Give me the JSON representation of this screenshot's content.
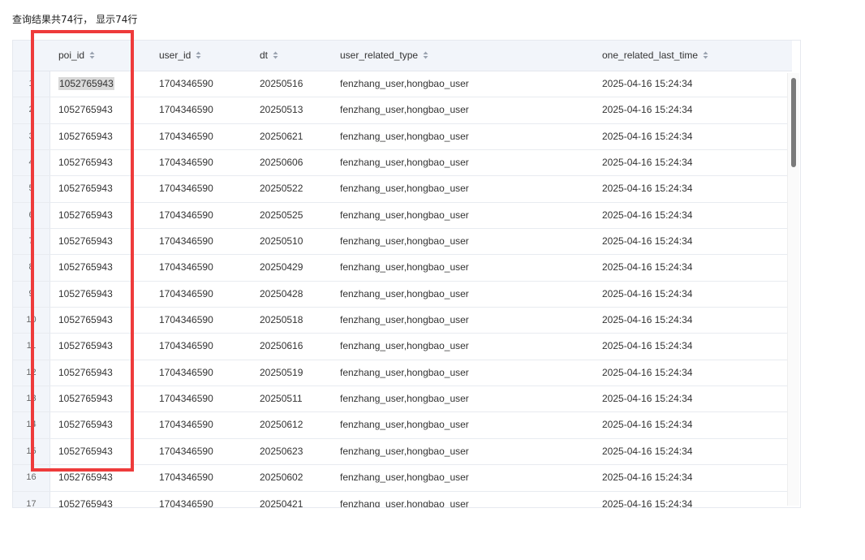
{
  "summary": "查询结果共74行， 显示74行",
  "columns": [
    {
      "key": "poi_id",
      "label": "poi_id"
    },
    {
      "key": "user_id",
      "label": "user_id"
    },
    {
      "key": "dt",
      "label": "dt"
    },
    {
      "key": "user_related_type",
      "label": "user_related_type"
    },
    {
      "key": "one_related_last_time",
      "label": "one_related_last_time"
    }
  ],
  "rows": [
    {
      "idx": "1",
      "poi_id": "1052765943",
      "user_id": "1704346590",
      "dt": "20250516",
      "user_related_type": "fenzhang_user,hongbao_user",
      "one_related_last_time": "2025-04-16 15:24:34"
    },
    {
      "idx": "2",
      "poi_id": "1052765943",
      "user_id": "1704346590",
      "dt": "20250513",
      "user_related_type": "fenzhang_user,hongbao_user",
      "one_related_last_time": "2025-04-16 15:24:34"
    },
    {
      "idx": "3",
      "poi_id": "1052765943",
      "user_id": "1704346590",
      "dt": "20250621",
      "user_related_type": "fenzhang_user,hongbao_user",
      "one_related_last_time": "2025-04-16 15:24:34"
    },
    {
      "idx": "4",
      "poi_id": "1052765943",
      "user_id": "1704346590",
      "dt": "20250606",
      "user_related_type": "fenzhang_user,hongbao_user",
      "one_related_last_time": "2025-04-16 15:24:34"
    },
    {
      "idx": "5",
      "poi_id": "1052765943",
      "user_id": "1704346590",
      "dt": "20250522",
      "user_related_type": "fenzhang_user,hongbao_user",
      "one_related_last_time": "2025-04-16 15:24:34"
    },
    {
      "idx": "6",
      "poi_id": "1052765943",
      "user_id": "1704346590",
      "dt": "20250525",
      "user_related_type": "fenzhang_user,hongbao_user",
      "one_related_last_time": "2025-04-16 15:24:34"
    },
    {
      "idx": "7",
      "poi_id": "1052765943",
      "user_id": "1704346590",
      "dt": "20250510",
      "user_related_type": "fenzhang_user,hongbao_user",
      "one_related_last_time": "2025-04-16 15:24:34"
    },
    {
      "idx": "8",
      "poi_id": "1052765943",
      "user_id": "1704346590",
      "dt": "20250429",
      "user_related_type": "fenzhang_user,hongbao_user",
      "one_related_last_time": "2025-04-16 15:24:34"
    },
    {
      "idx": "9",
      "poi_id": "1052765943",
      "user_id": "1704346590",
      "dt": "20250428",
      "user_related_type": "fenzhang_user,hongbao_user",
      "one_related_last_time": "2025-04-16 15:24:34"
    },
    {
      "idx": "10",
      "poi_id": "1052765943",
      "user_id": "1704346590",
      "dt": "20250518",
      "user_related_type": "fenzhang_user,hongbao_user",
      "one_related_last_time": "2025-04-16 15:24:34"
    },
    {
      "idx": "11",
      "poi_id": "1052765943",
      "user_id": "1704346590",
      "dt": "20250616",
      "user_related_type": "fenzhang_user,hongbao_user",
      "one_related_last_time": "2025-04-16 15:24:34"
    },
    {
      "idx": "12",
      "poi_id": "1052765943",
      "user_id": "1704346590",
      "dt": "20250519",
      "user_related_type": "fenzhang_user,hongbao_user",
      "one_related_last_time": "2025-04-16 15:24:34"
    },
    {
      "idx": "13",
      "poi_id": "1052765943",
      "user_id": "1704346590",
      "dt": "20250511",
      "user_related_type": "fenzhang_user,hongbao_user",
      "one_related_last_time": "2025-04-16 15:24:34"
    },
    {
      "idx": "14",
      "poi_id": "1052765943",
      "user_id": "1704346590",
      "dt": "20250612",
      "user_related_type": "fenzhang_user,hongbao_user",
      "one_related_last_time": "2025-04-16 15:24:34"
    },
    {
      "idx": "15",
      "poi_id": "1052765943",
      "user_id": "1704346590",
      "dt": "20250623",
      "user_related_type": "fenzhang_user,hongbao_user",
      "one_related_last_time": "2025-04-16 15:24:34"
    },
    {
      "idx": "16",
      "poi_id": "1052765943",
      "user_id": "1704346590",
      "dt": "20250602",
      "user_related_type": "fenzhang_user,hongbao_user",
      "one_related_last_time": "2025-04-16 15:24:34"
    },
    {
      "idx": "17",
      "poi_id": "1052765943",
      "user_id": "1704346590",
      "dt": "20250421",
      "user_related_type": "fenzhang_user,hongbao_user",
      "one_related_last_time": "2025-04-16 15:24:34"
    }
  ],
  "icons": {
    "sort": "sort-icon",
    "scroll_thumb": "scrollbar-thumb"
  },
  "colors": {
    "highlight_box": "#ee3b3b",
    "header_bg": "#f2f5fa",
    "selected_cell": "#d9d9d9"
  }
}
